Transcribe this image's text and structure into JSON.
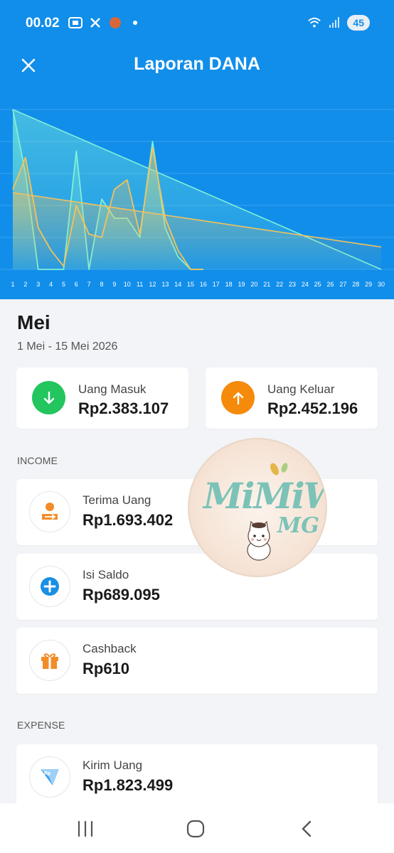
{
  "status_bar": {
    "time": "00.02",
    "battery": "45",
    "icons": [
      "screenshot-icon",
      "x-logo-icon",
      "app-notification-icon",
      "dot-icon",
      "wifi-icon",
      "signal-icon"
    ]
  },
  "header": {
    "title": "Laporan DANA",
    "close_icon": "close-icon",
    "background": "#118eea"
  },
  "chart_data": {
    "type": "line",
    "x": [
      1,
      2,
      3,
      4,
      5,
      6,
      7,
      8,
      9,
      10,
      11,
      12,
      13,
      14,
      15,
      16,
      17,
      18,
      19,
      20,
      21,
      22,
      23,
      24,
      25,
      26,
      27,
      28,
      29,
      30
    ],
    "tick_labels": [
      "1",
      "2",
      "3",
      "4",
      "5",
      "6",
      "7",
      "8",
      "9",
      "10",
      "11",
      "12",
      "13",
      "14",
      "15",
      "16",
      "17",
      "18",
      "19",
      "20",
      "21",
      "22",
      "23",
      "24",
      "25",
      "26",
      "27",
      "28",
      "29",
      "30"
    ],
    "ylim": [
      0,
      1
    ],
    "grid": true,
    "series": [
      {
        "color": "#7ff0d8",
        "values": [
          1.0,
          0.6,
          0.0,
          0.0,
          0.0,
          0.74,
          0.0,
          0.44,
          0.32,
          0.32,
          0.2,
          0.8,
          0.26,
          0.08,
          0.0,
          0.0,
          null,
          null,
          null,
          null,
          null,
          null,
          null,
          null,
          null,
          null,
          null,
          null,
          null,
          null
        ],
        "trend": [
          1.0,
          0.0
        ]
      },
      {
        "color": "#f5c25a",
        "values": [
          0.5,
          0.7,
          0.26,
          0.12,
          0.02,
          0.4,
          0.22,
          0.2,
          0.5,
          0.56,
          0.22,
          0.76,
          0.32,
          0.12,
          0.0,
          0.0,
          null,
          null,
          null,
          null,
          null,
          null,
          null,
          null,
          null,
          null,
          null,
          null,
          null,
          null
        ],
        "trend": [
          0.48,
          0.14
        ]
      }
    ]
  },
  "summary": {
    "month": "Mei",
    "range": "1 Mei - 15 Mei 2026",
    "income_label": "Uang Masuk",
    "income_value": "Rp2.383.107",
    "income_color": "#22c55e",
    "expense_label": "Uang Keluar",
    "expense_value": "Rp2.452.196",
    "expense_color": "#f59e0b"
  },
  "income": {
    "section_label": "INCOME",
    "items": [
      {
        "label": "Terima Uang",
        "value": "Rp1.693.402",
        "icon": "receive-money-icon"
      },
      {
        "label": "Isi Saldo",
        "value": "Rp689.095",
        "icon": "top-up-icon"
      },
      {
        "label": "Cashback",
        "value": "Rp610",
        "icon": "gift-icon"
      }
    ]
  },
  "expense": {
    "section_label": "EXPENSE",
    "items": [
      {
        "label": "Kirim Uang",
        "value": "Rp1.823.499",
        "icon": "send-money-icon"
      }
    ]
  },
  "sticker": {
    "line1": "MiMiW",
    "line2": "MG"
  },
  "navbar": {
    "icons": [
      "recent-apps-icon",
      "home-icon",
      "back-icon"
    ]
  }
}
